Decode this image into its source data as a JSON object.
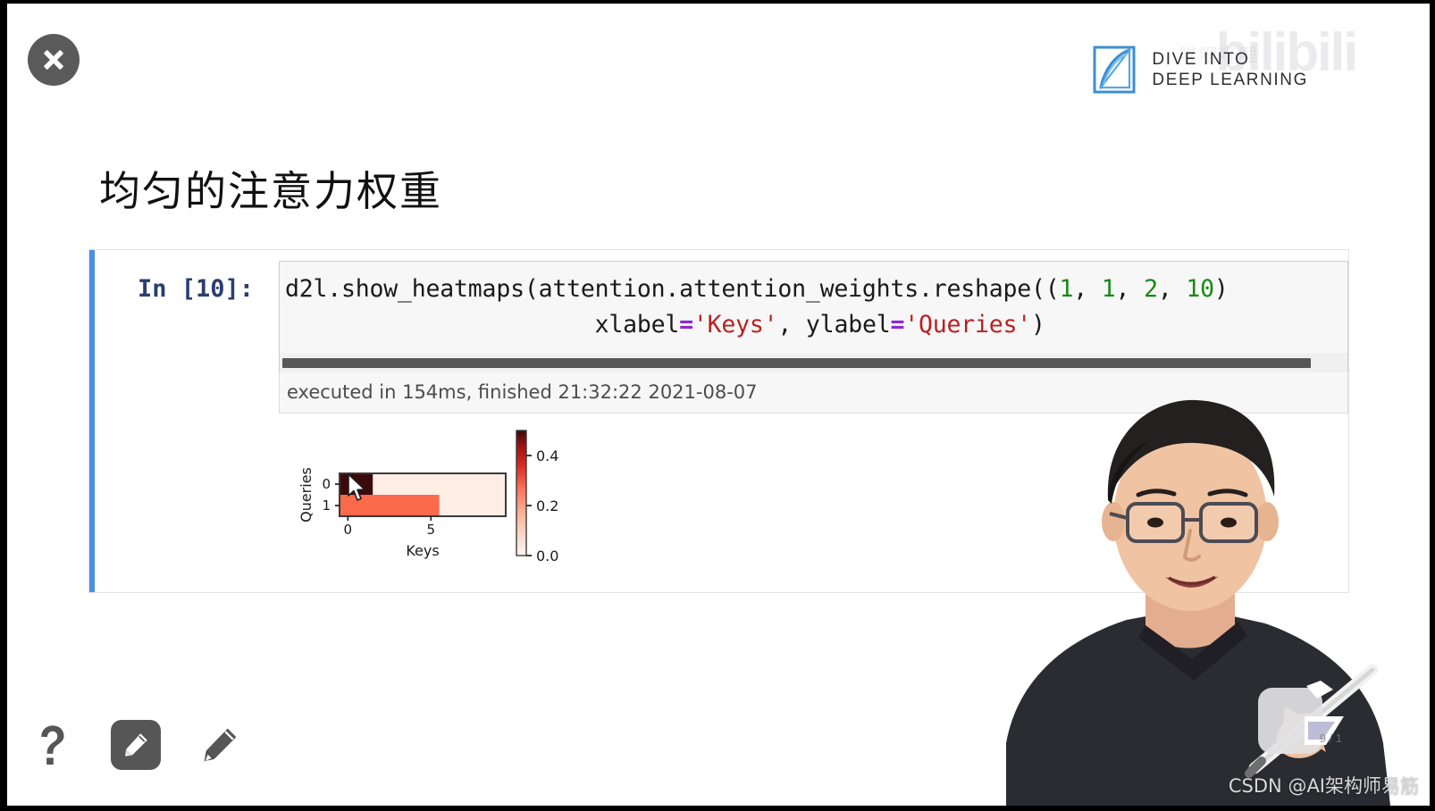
{
  "window": {
    "close_button": "close-icon"
  },
  "brand": {
    "logo_line1": "DIVE INTO",
    "logo_line2": "DEEP LEARNING",
    "watermark_main": "bilibili",
    "watermark_sub": "哔哩哔哩"
  },
  "slide": {
    "title": "均匀的注意力权重"
  },
  "notebook": {
    "prompt": "In [10]:",
    "code_lines": [
      {
        "segments": [
          {
            "text": "d2l.show_heatmaps(attention.attention_weights.reshape((",
            "kind": "plain"
          },
          {
            "text": "1",
            "kind": "number"
          },
          {
            "text": ", ",
            "kind": "plain"
          },
          {
            "text": "1",
            "kind": "number"
          },
          {
            "text": ", ",
            "kind": "plain"
          },
          {
            "text": "2",
            "kind": "number"
          },
          {
            "text": ", ",
            "kind": "plain"
          },
          {
            "text": "10",
            "kind": "number"
          },
          {
            "text": ")",
            "kind": "plain"
          }
        ]
      },
      {
        "segments": [
          {
            "text": "                      xlabel",
            "kind": "plain"
          },
          {
            "text": "=",
            "kind": "operator"
          },
          {
            "text": "'Keys'",
            "kind": "string"
          },
          {
            "text": ", ylabel",
            "kind": "plain"
          },
          {
            "text": "=",
            "kind": "operator"
          },
          {
            "text": "'Queries'",
            "kind": "string"
          },
          {
            "text": ")",
            "kind": "plain"
          }
        ]
      }
    ],
    "execution_status": "executed in 154ms, finished 21:32:22 2021-08-07",
    "horizontal_scrollbar": "code-h-scrollbar"
  },
  "chart_data": {
    "type": "heatmap",
    "title": "",
    "xlabel": "Keys",
    "ylabel": "Queries",
    "xticks": [
      0,
      5
    ],
    "yticks": [
      0,
      1
    ],
    "xlim": [
      -0.5,
      9.5
    ],
    "ylim": [
      1.5,
      -0.5
    ],
    "grid": false,
    "colormap": "Reds",
    "colorbar": {
      "ticks": [
        "0.0",
        "0.2",
        "0.4"
      ],
      "vmin": 0.0,
      "vmax": 0.5,
      "position": "right"
    },
    "rows": 2,
    "cols": 10,
    "values": [
      [
        0.5,
        0.5,
        0.02,
        0.02,
        0.02,
        0.02,
        0.02,
        0.02,
        0.02,
        0.02
      ],
      [
        0.25,
        0.25,
        0.25,
        0.25,
        0.25,
        0.25,
        0.02,
        0.02,
        0.02,
        0.02
      ]
    ],
    "annotations": []
  },
  "overlay": {
    "page_indicator": "9 / 1",
    "csdn_watermark": "CSDN @AI架构师易筋"
  },
  "toolbar": {
    "items": [
      {
        "icon": "question-mark-icon",
        "label": "Help",
        "active": false
      },
      {
        "icon": "pencil-boxed-icon",
        "label": "Annotate",
        "active": true
      },
      {
        "icon": "pencil-icon",
        "label": "Draw",
        "active": false
      }
    ]
  },
  "colors": {
    "cell_accent": "#4a90e2",
    "prompt": "#293f6f",
    "string": "#ba2121",
    "number": "#178a17",
    "operator": "#8b27d6",
    "heatmap_dark": "#3d0a0a",
    "heatmap_mid": "#e8836a",
    "heatmap_light": "#fdf0e9"
  }
}
